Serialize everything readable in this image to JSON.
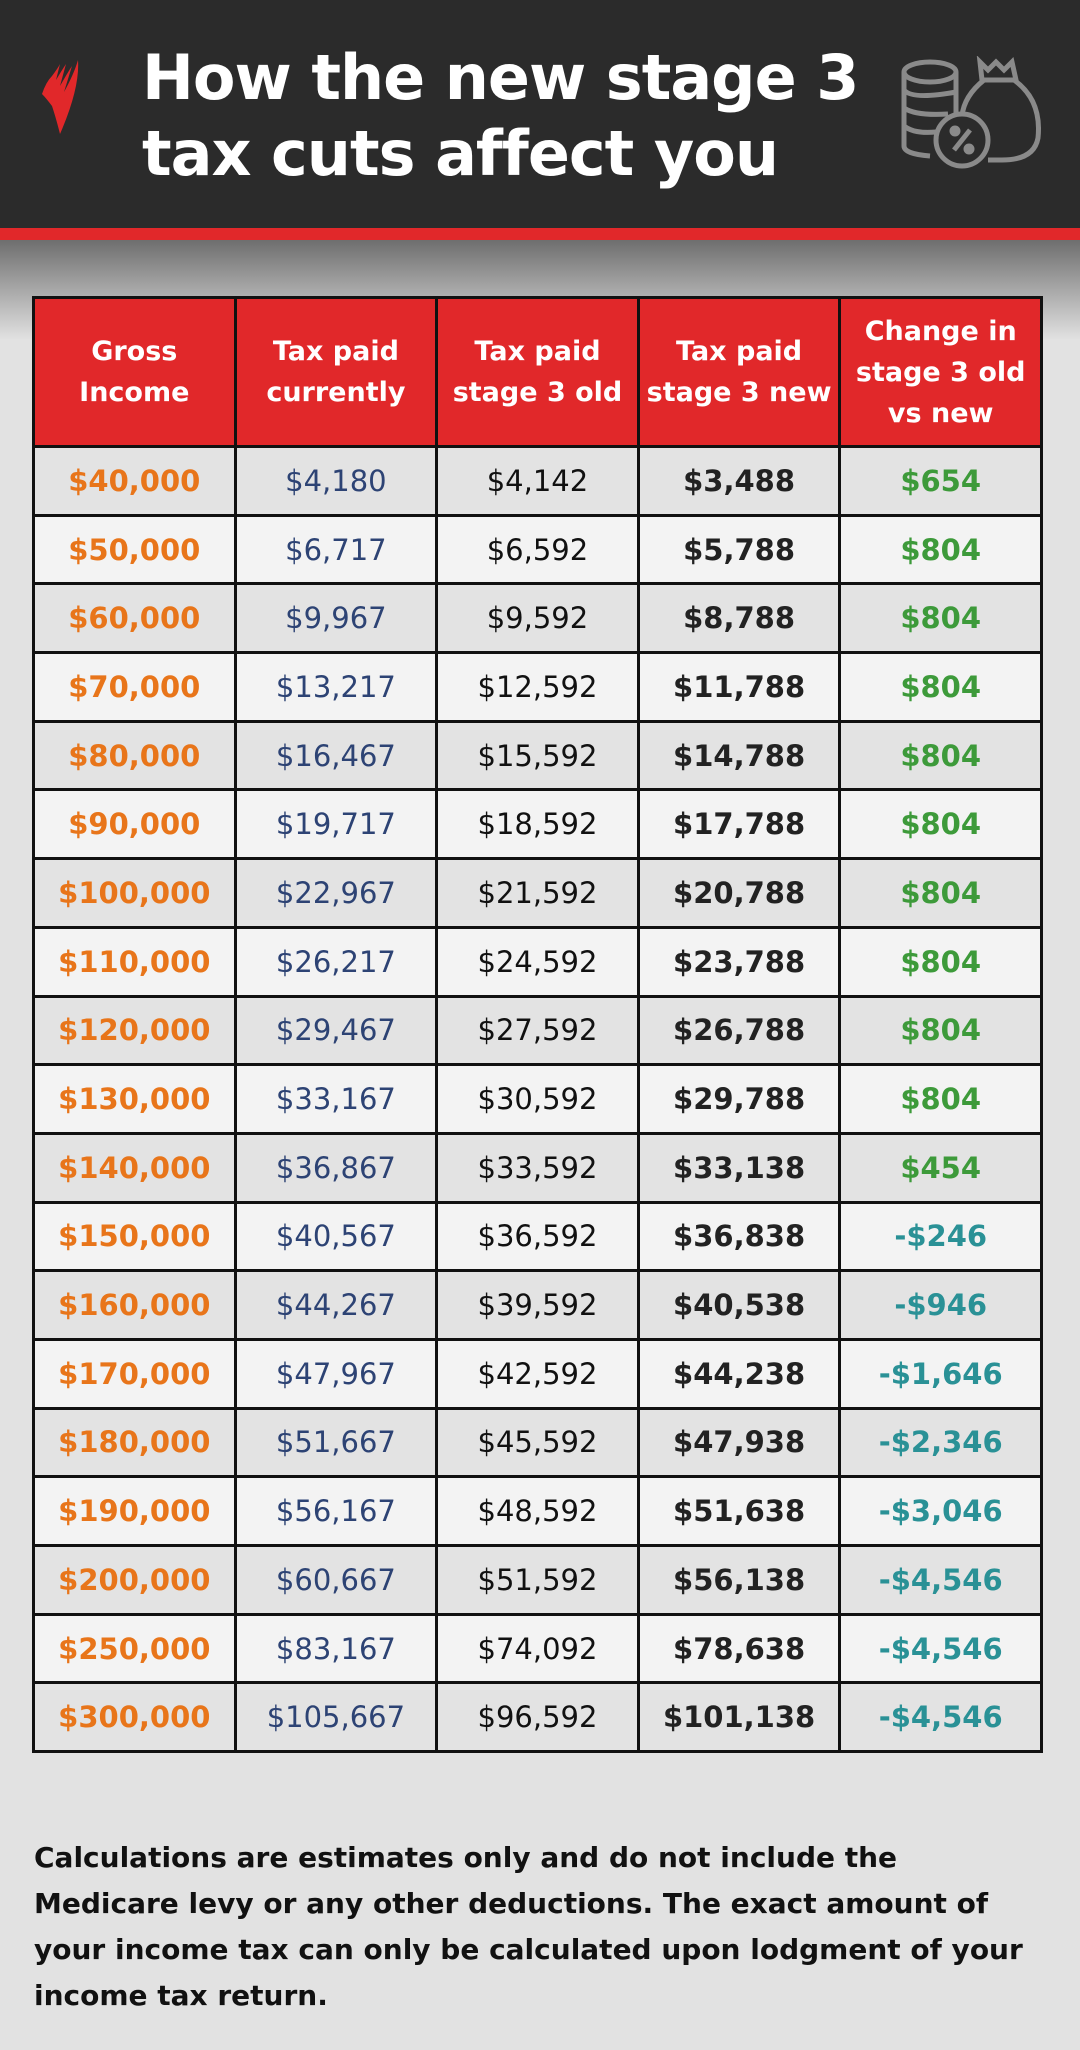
{
  "header": {
    "title": "How the new stage 3\ntax cuts affect you",
    "logo_icon": "sbs-logo-icon",
    "decor_icon": "coins-money-bag-percent-icon"
  },
  "colors": {
    "header_bg": "#2b2b2b",
    "accent_red": "#e1282a",
    "income_orange": "#e8751a",
    "current_blue": "#2d4374",
    "positive_green": "#3d9a3a",
    "negative_teal": "#2a9196"
  },
  "table": {
    "columns": [
      "Gross Income",
      "Tax paid currently",
      "Tax paid stage 3 old",
      "Tax paid stage 3 new",
      "Change in stage 3 old vs new"
    ],
    "rows": [
      {
        "income": "$40,000",
        "current": "$4,180",
        "old": "$4,142",
        "new": "$3,488",
        "change": "$654",
        "sign": "pos"
      },
      {
        "income": "$50,000",
        "current": "$6,717",
        "old": "$6,592",
        "new": "$5,788",
        "change": "$804",
        "sign": "pos"
      },
      {
        "income": "$60,000",
        "current": "$9,967",
        "old": "$9,592",
        "new": "$8,788",
        "change": "$804",
        "sign": "pos"
      },
      {
        "income": "$70,000",
        "current": "$13,217",
        "old": "$12,592",
        "new": "$11,788",
        "change": "$804",
        "sign": "pos"
      },
      {
        "income": "$80,000",
        "current": "$16,467",
        "old": "$15,592",
        "new": "$14,788",
        "change": "$804",
        "sign": "pos"
      },
      {
        "income": "$90,000",
        "current": "$19,717",
        "old": "$18,592",
        "new": "$17,788",
        "change": "$804",
        "sign": "pos"
      },
      {
        "income": "$100,000",
        "current": "$22,967",
        "old": "$21,592",
        "new": "$20,788",
        "change": "$804",
        "sign": "pos"
      },
      {
        "income": "$110,000",
        "current": "$26,217",
        "old": "$24,592",
        "new": "$23,788",
        "change": "$804",
        "sign": "pos"
      },
      {
        "income": "$120,000",
        "current": "$29,467",
        "old": "$27,592",
        "new": "$26,788",
        "change": "$804",
        "sign": "pos"
      },
      {
        "income": "$130,000",
        "current": "$33,167",
        "old": "$30,592",
        "new": "$29,788",
        "change": "$804",
        "sign": "pos"
      },
      {
        "income": "$140,000",
        "current": "$36,867",
        "old": "$33,592",
        "new": "$33,138",
        "change": "$454",
        "sign": "pos"
      },
      {
        "income": "$150,000",
        "current": "$40,567",
        "old": "$36,592",
        "new": "$36,838",
        "change": "-$246",
        "sign": "neg"
      },
      {
        "income": "$160,000",
        "current": "$44,267",
        "old": "$39,592",
        "new": "$40,538",
        "change": "-$946",
        "sign": "neg"
      },
      {
        "income": "$170,000",
        "current": "$47,967",
        "old": "$42,592",
        "new": "$44,238",
        "change": "-$1,646",
        "sign": "neg"
      },
      {
        "income": "$180,000",
        "current": "$51,667",
        "old": "$45,592",
        "new": "$47,938",
        "change": "-$2,346",
        "sign": "neg"
      },
      {
        "income": "$190,000",
        "current": "$56,167",
        "old": "$48,592",
        "new": "$51,638",
        "change": "-$3,046",
        "sign": "neg"
      },
      {
        "income": "$200,000",
        "current": "$60,667",
        "old": "$51,592",
        "new": "$56,138",
        "change": "-$4,546",
        "sign": "neg"
      },
      {
        "income": "$250,000",
        "current": "$83,167",
        "old": "$74,092",
        "new": "$78,638",
        "change": "-$4,546",
        "sign": "neg"
      },
      {
        "income": "$300,000",
        "current": "$105,667",
        "old": "$96,592",
        "new": "$101,138",
        "change": "-$4,546",
        "sign": "neg"
      }
    ]
  },
  "footnote": "Calculations are estimates only and do not include the Medicare levy or any other deductions.  The exact amount of your income tax can only be calculated upon lodgment of your income tax return."
}
